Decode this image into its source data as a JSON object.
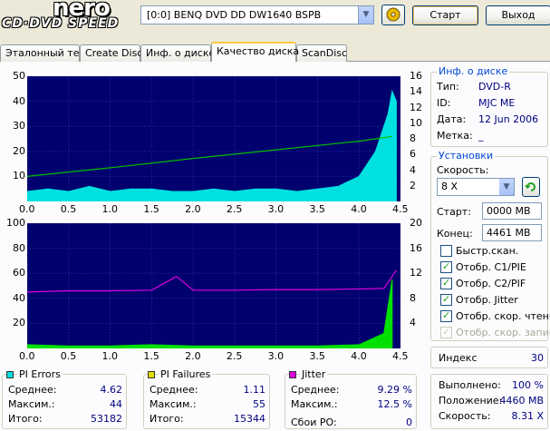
{
  "header": {
    "logo_top": "nero",
    "logo_bottom": "CD·DVD SPEED",
    "drive": "[0:0]  BENQ DVD DD DW1640 BSPB",
    "start_label": "Старт",
    "exit_label": "Выход"
  },
  "tabs": [
    {
      "label": "Эталонный тест"
    },
    {
      "label": "Create Disc"
    },
    {
      "label": "Инф. о диске"
    },
    {
      "label": "Качество диска",
      "active": true
    },
    {
      "label": "ScanDisc"
    }
  ],
  "disc_info": {
    "title": "Инф. о диске",
    "type_label": "Тип:",
    "type_value": "DVD-R",
    "id_label": "ID:",
    "id_value": "MJC ME",
    "date_label": "Дата:",
    "date_value": "12 Jun 2006",
    "mark_label": "Метка:",
    "mark_value": "_"
  },
  "settings": {
    "title": "Установки",
    "speed_label": "Скорость:",
    "speed_value": "8 X",
    "start_label": "Старт:",
    "start_value": "0000 MB",
    "end_label": "Конец:",
    "end_value": "4461 MB",
    "checks": [
      {
        "label": "Быстр.скан.",
        "checked": false,
        "disabled": false
      },
      {
        "label": "Отобр. C1/PIE",
        "checked": true,
        "disabled": false
      },
      {
        "label": "Отобр. C2/PIF",
        "checked": true,
        "disabled": false
      },
      {
        "label": "Отобр. Jitter",
        "checked": true,
        "disabled": false
      },
      {
        "label": "Отобр. скор. чтения",
        "checked": true,
        "disabled": false
      },
      {
        "label": "Отобр. скор. записи",
        "checked": true,
        "disabled": true
      }
    ]
  },
  "index": {
    "label": "Индекс",
    "value": "30"
  },
  "progress": {
    "done_label": "Выполнено:",
    "done_value": "100 %",
    "pos_label": "Положение:",
    "pos_value": "4460 MB",
    "speed_label": "Скорость:",
    "speed_value": "8.31 X"
  },
  "stats": {
    "pie": {
      "title": "PI Errors",
      "color": "#00e0e0",
      "avg_label": "Среднее:",
      "avg": "4.62",
      "max_label": "Максим.:",
      "max": "44",
      "total_label": "Итого:",
      "total": "53182"
    },
    "pif": {
      "title": "PI Failures",
      "color": "#e0e000",
      "avg_label": "Среднее:",
      "avg": "1.11",
      "max_label": "Максим.:",
      "max": "55",
      "total_label": "Итого:",
      "total": "15344"
    },
    "jitter": {
      "title": "Jitter",
      "color": "#e000e0",
      "avg_label": "Среднее:",
      "avg": "9.29 %",
      "max_label": "Максим.:",
      "max": "12.5 %",
      "po_label": "Сбои PO:",
      "po": "0"
    }
  },
  "chart_data": [
    {
      "type": "area",
      "x_ticks": [
        "0.0",
        "0.5",
        "1.0",
        "1.5",
        "2.0",
        "2.5",
        "3.0",
        "3.5",
        "4.0",
        "4.5"
      ],
      "y_left_ticks": [
        "50",
        "40",
        "30",
        "20",
        "10"
      ],
      "y_right_ticks": [
        "16",
        "14",
        "12",
        "10",
        "8",
        "6",
        "4",
        "2"
      ],
      "xlim": [
        0,
        4.5
      ],
      "ylim_left": [
        0,
        50
      ],
      "ylim_right": [
        0,
        16
      ],
      "series": [
        {
          "color": "#00e0e0",
          "x": [
            0,
            0.25,
            0.5,
            0.75,
            1,
            1.25,
            1.5,
            1.75,
            2,
            2.25,
            2.5,
            2.75,
            3,
            3.25,
            3.5,
            3.75,
            4,
            4.1,
            4.2,
            4.3,
            4.35,
            4.4,
            4.45
          ],
          "y": [
            4,
            5,
            4,
            6,
            4,
            5,
            5,
            4,
            4,
            5,
            4,
            5,
            5,
            4,
            5,
            6,
            10,
            15,
            20,
            30,
            35,
            44,
            40
          ]
        },
        {
          "color": "#00c000",
          "axis": "right",
          "x": [
            0,
            1,
            2,
            3,
            4,
            4.4
          ],
          "y": [
            3.2,
            4.3,
            5.5,
            6.6,
            7.7,
            8.3
          ]
        }
      ]
    },
    {
      "type": "area",
      "x_ticks": [
        "0.0",
        "0.5",
        "1.0",
        "1.5",
        "2.0",
        "2.5",
        "3.0",
        "3.5",
        "4.0",
        "4.5"
      ],
      "y_left_ticks": [
        "100",
        "80",
        "60",
        "40",
        "20"
      ],
      "y_right_ticks": [
        "20",
        "16",
        "12",
        "8",
        "4"
      ],
      "xlim": [
        0,
        4.5
      ],
      "ylim_left": [
        0,
        100
      ],
      "ylim_right": [
        0,
        20
      ],
      "series": [
        {
          "color": "#00e000",
          "x": [
            0,
            0.5,
            1,
            1.5,
            2,
            2.5,
            3,
            3.5,
            4,
            4.3,
            4.4
          ],
          "y": [
            3,
            2,
            2,
            3,
            2,
            2,
            2,
            2,
            3,
            12,
            55
          ]
        },
        {
          "color": "#e000e0",
          "axis": "right",
          "x": [
            0,
            0.5,
            1,
            1.5,
            1.8,
            2,
            2.5,
            3,
            3.5,
            4,
            4.3,
            4.45
          ],
          "y": [
            9.0,
            9.2,
            9.2,
            9.3,
            11.5,
            9.3,
            9.3,
            9.4,
            9.4,
            9.5,
            9.6,
            12.5
          ]
        }
      ]
    }
  ]
}
